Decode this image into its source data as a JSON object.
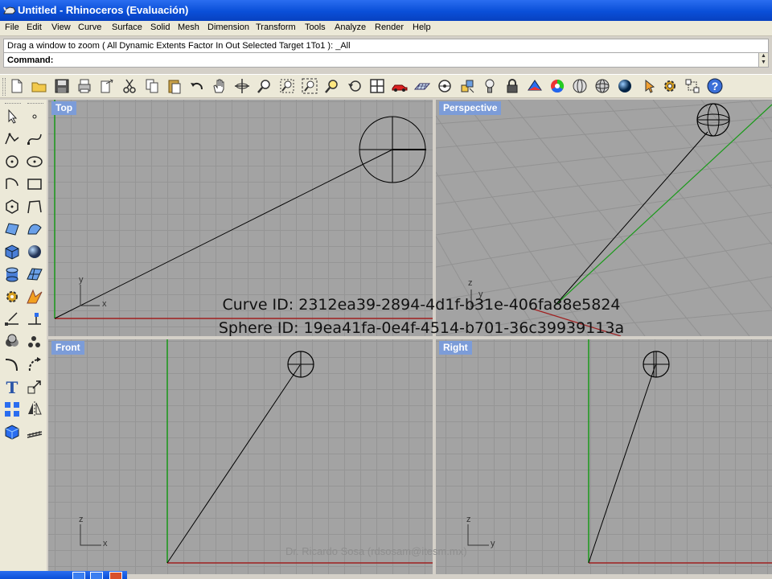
{
  "window": {
    "title": "Untitled - Rhinoceros (Evaluación)",
    "app_icon": "rhino-icon"
  },
  "menu": {
    "items": [
      "File",
      "Edit",
      "View",
      "Curve",
      "Surface",
      "Solid",
      "Mesh",
      "Dimension",
      "Transform",
      "Tools",
      "Analyze",
      "Render",
      "Help"
    ]
  },
  "command": {
    "history": "Drag a window to zoom ( All  Dynamic  Extents  Factor  In  Out  Selected  Target  1To1 ): _All",
    "prompt": "Command:"
  },
  "toolbar": {
    "icons": [
      "new-file-icon",
      "open-folder-icon",
      "save-icon",
      "print-icon",
      "export-icon",
      "cut-icon",
      "copy-icon",
      "paste-icon",
      "undo-icon",
      "pan-hand-icon",
      "rotate-view-icon",
      "zoom-window-icon",
      "zoom-dynamic-icon",
      "zoom-extents-icon",
      "zoom-selected-icon",
      "undo-view-icon",
      "four-viewports-icon",
      "car-icon",
      "cplane-icon",
      "snap-icon",
      "layer-icon",
      "light-bulb-icon",
      "lock-icon",
      "shade-icon",
      "color-wheel-icon",
      "wireframe-sphere-icon",
      "render-sphere-icon",
      "blue-sphere-icon",
      "select-icon",
      "options-gear-icon",
      "gumball-icon",
      "help-icon"
    ]
  },
  "sidebar": {
    "icons": [
      "select-arrow-icon",
      "point-icon",
      "polyline-icon",
      "curve-icon",
      "circle-icon",
      "ellipse-icon",
      "arc-icon",
      "rectangle-icon",
      "polygon-icon",
      "freeform-curve-icon",
      "surface-icon",
      "surface-edit-icon",
      "box-icon",
      "sphere-solid-icon",
      "cylinder-icon",
      "mesh-surface-icon",
      "transform-gear-icon",
      "explode-icon",
      "trim-icon",
      "split-icon",
      "boolean-icon",
      "array-icon",
      "fillet-icon",
      "rotate-icon",
      "text-icon",
      "scale-icon",
      "group-icon",
      "mirror-icon",
      "solid-box-icon",
      "dimension-icon"
    ]
  },
  "viewports": {
    "top": {
      "label": "Top",
      "axis_x": "x",
      "axis_y": "y"
    },
    "perspective": {
      "label": "Perspective",
      "axis_z": "z",
      "axis_y": "y"
    },
    "front": {
      "label": "Front",
      "axis_x": "x",
      "axis_z": "z"
    },
    "right": {
      "label": "Right",
      "axis_y": "y",
      "axis_z": "z"
    }
  },
  "overlay": {
    "curve_id": "Curve ID: 2312ea39-2894-4d1f-b31e-406fa88e5824",
    "sphere_id": "Sphere ID: 19ea41fa-0e4f-4514-b701-36c39939113a"
  },
  "watermark": "Dr. Ricardo Sosa (rdsosam@itesm.mx)",
  "colors": {
    "title_bar": "#0a4fd8",
    "viewport_bg": "#a3a3a3",
    "grid_line": "#959595",
    "x_axis": "#a02020",
    "y_axis": "#1a9a1a",
    "viewport_label": "#7c9cd8"
  }
}
